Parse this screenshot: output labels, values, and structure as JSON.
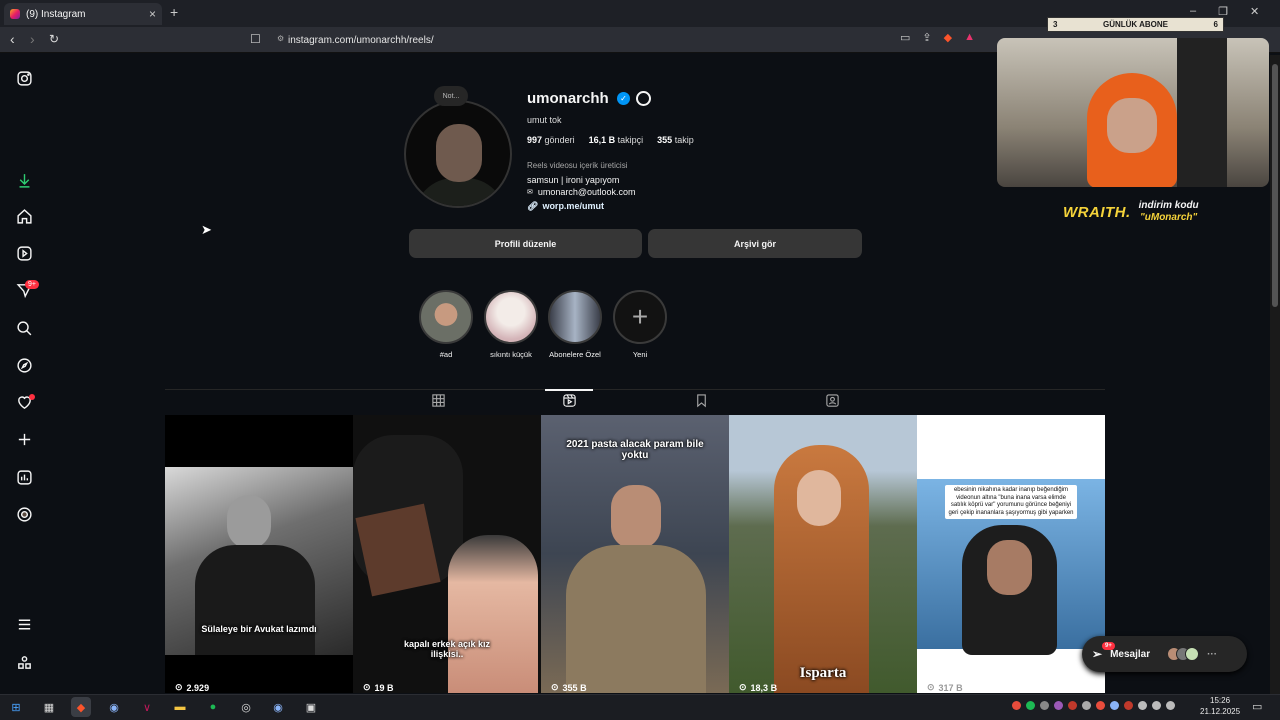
{
  "browser": {
    "tab_title": "(9) Instagram",
    "url": "instagram.com/umonarchh/reels/"
  },
  "overlay": {
    "sub_count_left": "3",
    "sub_label": "GÜNLÜK ABONE",
    "sub_count_right": "6",
    "brand": "WRAITH.",
    "promo_line1": "indirim kodu",
    "promo_code": "\"uMonarch\""
  },
  "sidebar": {
    "notif_badge": "9+"
  },
  "profile": {
    "note": "Not...",
    "username": "umonarchh",
    "full_name": "umut tok",
    "posts_count": "997",
    "posts_label": "gönderi",
    "followers_count": "16,1 B",
    "followers_label": "takipçi",
    "following_count": "355",
    "following_label": "takip",
    "category": "Reels videosu içerik üreticisi",
    "bio_line1": "samsun | ironi yapıyom",
    "bio_email": "umonarch@outlook.com",
    "link": "worp.me/umut",
    "edit_button": "Profili düzenle",
    "archive_button": "Arşivi gör"
  },
  "highlights": [
    {
      "label": "#ad"
    },
    {
      "label": "sıkıntı küçük"
    },
    {
      "label": "Abonelere Özel"
    },
    {
      "label": "Yeni"
    }
  ],
  "reels": [
    {
      "caption": "Sülaleye bir Avukat lazımdı",
      "views": "2.929"
    },
    {
      "caption": "kapalı erkek açık kız ilişkisi..",
      "views": "19 B"
    },
    {
      "caption": "2021 pasta alacak param bile yoktu",
      "views": "355 B"
    },
    {
      "caption": "Isparta",
      "views": "18,3 B"
    },
    {
      "caption": "ebesinin nikahına kadar inanıp beğendiğim videonun altına \"buna inana varsa elimde satılık köprü var\" yorumunu görünce beğeniyi geri çekip inananlara şaşıyormuş gibi yaparken",
      "views": "317 B"
    }
  ],
  "messages": {
    "label": "Mesajlar",
    "badge": "9+"
  },
  "taskbar": {
    "time": "15:26",
    "date": "21.12.2025"
  }
}
